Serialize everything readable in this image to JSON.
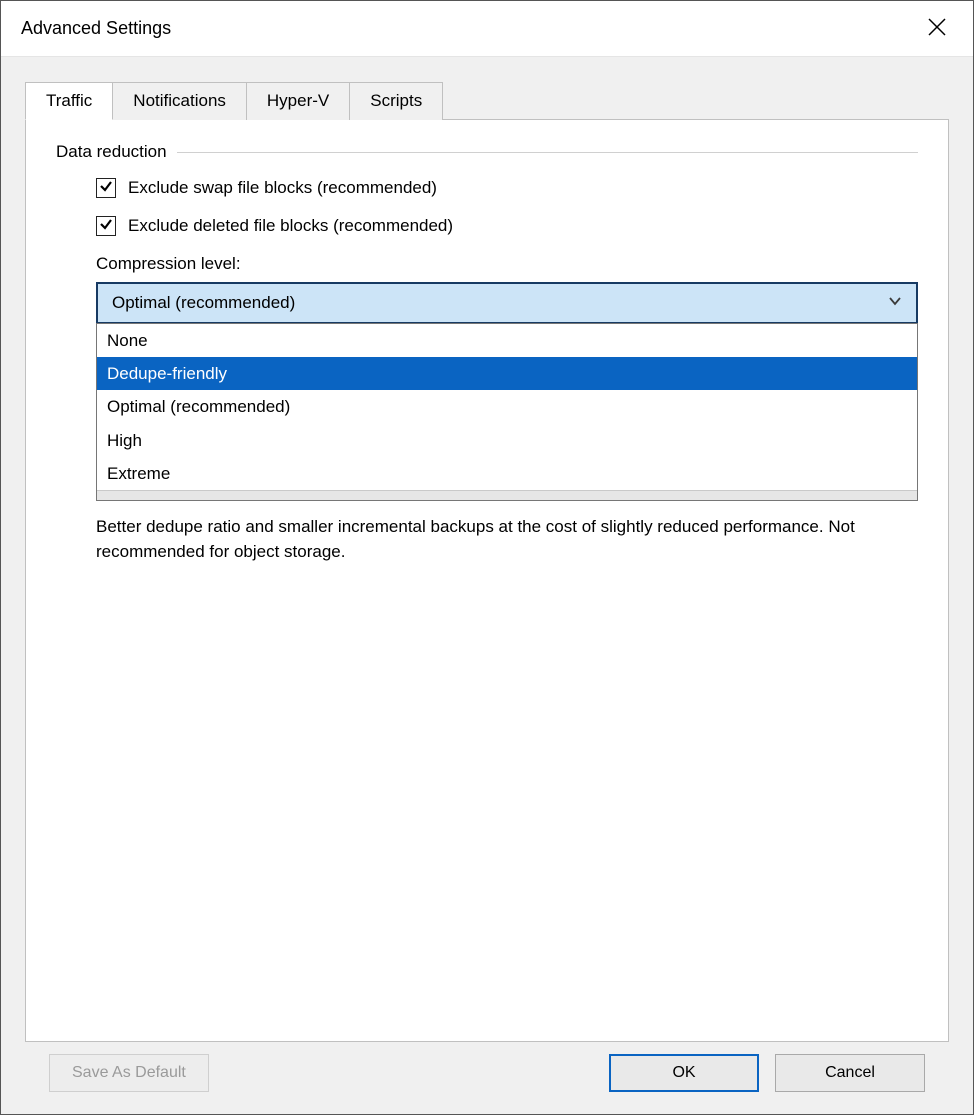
{
  "window": {
    "title": "Advanced Settings"
  },
  "tabs": [
    {
      "label": "Traffic",
      "active": true
    },
    {
      "label": "Notifications",
      "active": false
    },
    {
      "label": "Hyper-V",
      "active": false
    },
    {
      "label": "Scripts",
      "active": false
    }
  ],
  "traffic": {
    "group_label": "Data reduction",
    "exclude_swap": {
      "label": "Exclude swap file blocks (recommended)",
      "checked": true
    },
    "exclude_deleted": {
      "label": "Exclude deleted file blocks (recommended)",
      "checked": true
    },
    "compression_label": "Compression level:",
    "compression_selected": "Optimal (recommended)",
    "compression_options": [
      {
        "label": "None",
        "highlighted": false
      },
      {
        "label": "Dedupe-friendly",
        "highlighted": true
      },
      {
        "label": "Optimal (recommended)",
        "highlighted": false
      },
      {
        "label": "High",
        "highlighted": false
      },
      {
        "label": "Extreme",
        "highlighted": false
      }
    ],
    "description": "Better dedupe ratio and smaller incremental backups at the cost of slightly reduced performance. Not recommended for object storage."
  },
  "buttons": {
    "save_default": "Save As Default",
    "ok": "OK",
    "cancel": "Cancel"
  }
}
